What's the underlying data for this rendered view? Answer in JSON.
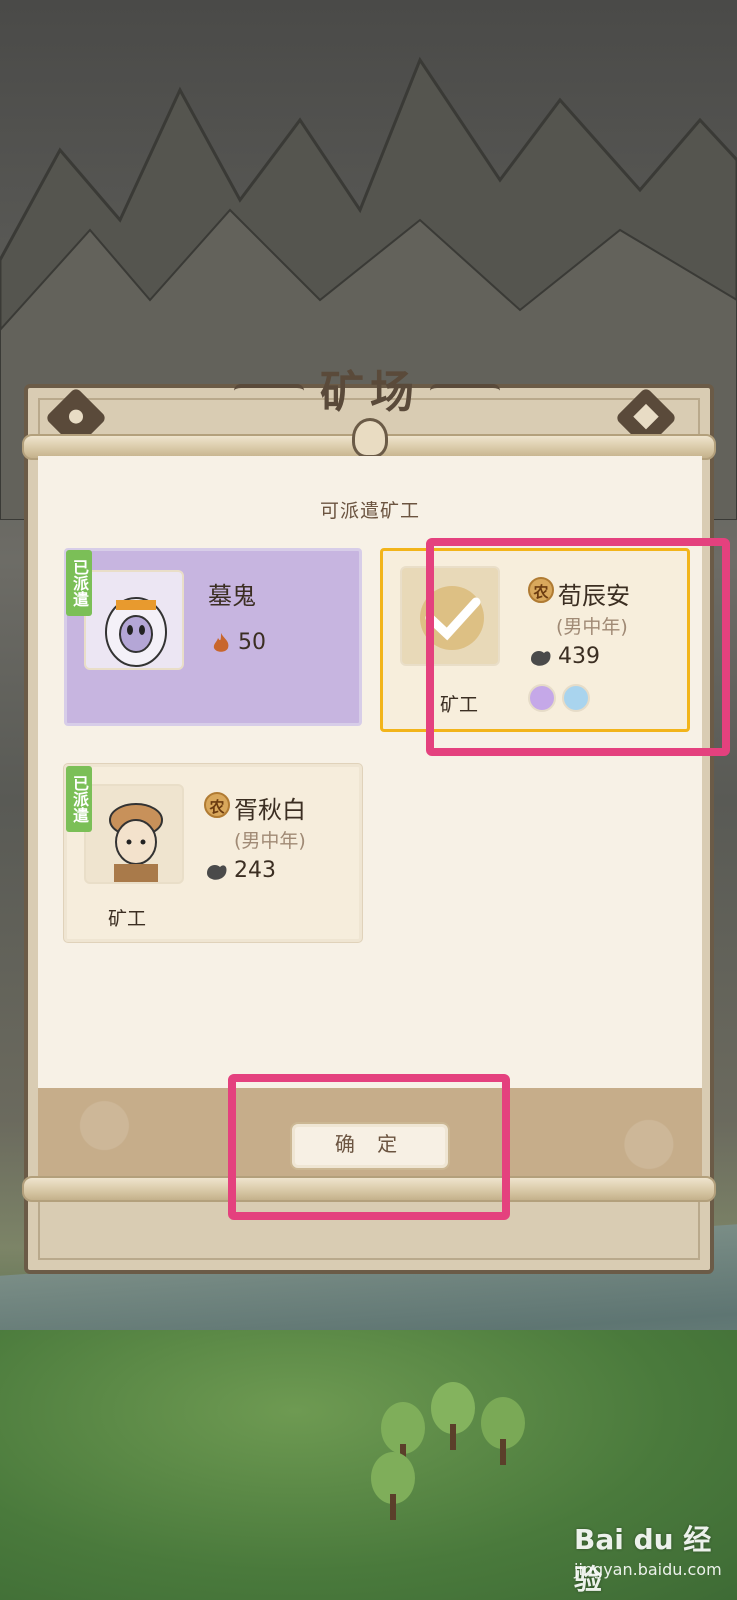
{
  "panel": {
    "title": "矿场",
    "subtitle": "可派遣矿工",
    "confirm_label": "确 定"
  },
  "workers": [
    {
      "name": "墓鬼",
      "badge": "已派遣",
      "stat_icon": "fire-icon",
      "stat_value": "50",
      "card_color": "#c7b5e0"
    },
    {
      "name": "荀辰安",
      "tag": "农",
      "subtitle": "(男中年)",
      "stat_icon": "strength-icon",
      "stat_value": "439",
      "role": "矿工",
      "selected": true,
      "skills": [
        "purple-skill-icon",
        "blue-skill-icon"
      ]
    },
    {
      "name": "胥秋白",
      "badge": "已派遣",
      "tag": "农",
      "subtitle": "(男中年)",
      "stat_icon": "strength-icon",
      "stat_value": "243",
      "role": "矿工"
    }
  ],
  "watermark": {
    "brand": "Bai du 经验",
    "url": "jingyan.baidu.com"
  },
  "colors": {
    "highlight": "#e4417e",
    "selected_border": "#f2b41a",
    "dispatched_badge": "#7bbf57"
  }
}
